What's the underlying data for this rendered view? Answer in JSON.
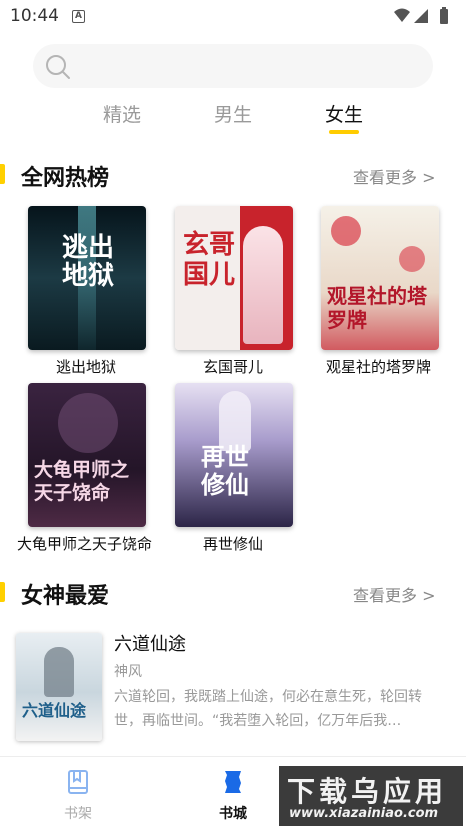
{
  "status_bar": {
    "time": "10:44",
    "notification_letter": "A"
  },
  "search": {
    "placeholder": ""
  },
  "tabs": [
    {
      "label": "精选",
      "active": false
    },
    {
      "label": "男生",
      "active": false
    },
    {
      "label": "女生",
      "active": true
    }
  ],
  "hot_ranking": {
    "title": "全网热榜",
    "more": "查看更多 >",
    "books": [
      {
        "title": "逃出地狱",
        "cover_text": "逃出地狱",
        "cover_colors": [
          "#0b1a22",
          "#1d3c46"
        ]
      },
      {
        "title": "玄国哥儿",
        "cover_text": "玄哥国儿",
        "cover_colors": [
          "#f4f0ee",
          "#c8232c"
        ]
      },
      {
        "title": "观星社的塔罗牌",
        "cover_text": "观星社的塔罗牌",
        "cover_colors": [
          "#f3efe6",
          "#c92b3a"
        ]
      },
      {
        "title": "大龟甲师之天子饶命",
        "cover_text": "大龟甲师之天子饶命",
        "cover_colors": [
          "#2a1830",
          "#5e3050"
        ]
      },
      {
        "title": "再世修仙",
        "cover_text": "再世修仙",
        "cover_colors": [
          "#d9d2ea",
          "#4a3d7a"
        ]
      }
    ]
  },
  "goddess_favorite": {
    "title": "女神最爱",
    "more": "查看更多 >",
    "item": {
      "title": "六道仙途",
      "author": "神风",
      "description": "六道轮回，我既踏上仙途，何必在意生死，轮回转世，再临世间。“我若堕入轮回，亿万年后我…",
      "cover_text": "六道仙途"
    }
  },
  "bottom_nav": [
    {
      "label": "书架",
      "active": false,
      "icon": "book-icon"
    },
    {
      "label": "书城",
      "active": true,
      "icon": "store-icon"
    }
  ],
  "watermark": {
    "main": "下载乌应用",
    "url": "www.xiazainiao.com"
  },
  "colors": {
    "accent": "#ffcc00",
    "text_muted": "#999999"
  }
}
